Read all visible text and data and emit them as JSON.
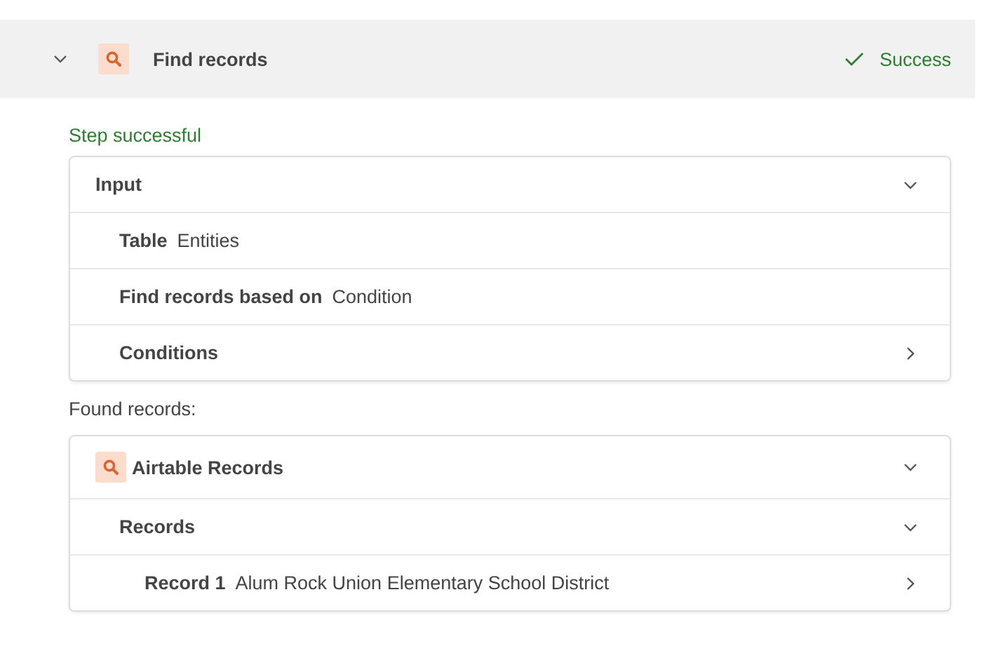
{
  "step": {
    "title": "Find records",
    "status": "Success",
    "expanded": true
  },
  "message": "Step successful",
  "input": {
    "label": "Input",
    "expanded": true,
    "rows": [
      {
        "kind": "field",
        "label": "Table",
        "value": "Entities"
      },
      {
        "kind": "field",
        "label": "Find records based on",
        "value": "Condition"
      },
      {
        "kind": "group",
        "label": "Conditions",
        "expanded": false
      }
    ]
  },
  "found_label": "Found records:",
  "output": {
    "title": "Airtable Records",
    "expanded": true,
    "children": [
      {
        "label": "Records",
        "expanded": true,
        "children": [
          {
            "label": "Record 1",
            "value": "Alum Rock Union Elementary School District",
            "expanded": false
          }
        ]
      }
    ]
  }
}
